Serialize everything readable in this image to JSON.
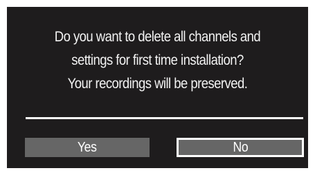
{
  "dialog": {
    "message_lines": [
      "Do you want to delete all channels and",
      "settings for first time installation?",
      "Your recordings will be preserved."
    ],
    "buttons": {
      "yes_label": "Yes",
      "no_label": "No",
      "focused": "No"
    }
  },
  "colors": {
    "dialog_background": "#1e1c1d",
    "button_background": "#666666",
    "focus_border": "#ffffff",
    "text": "#ffffff"
  }
}
